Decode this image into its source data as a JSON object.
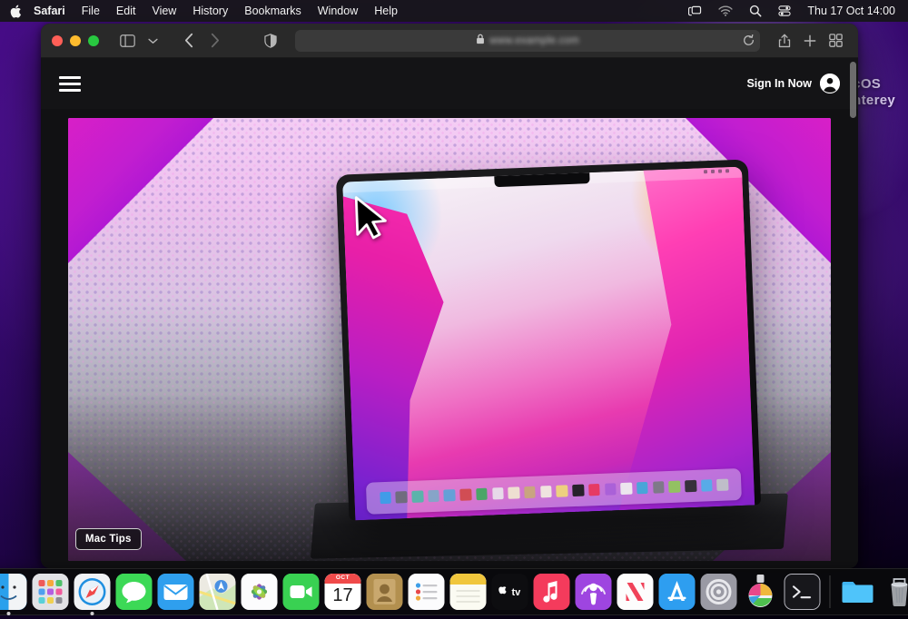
{
  "menubar": {
    "apple_icon": "apple-logo-icon",
    "items": [
      {
        "label": "Safari",
        "bold": true
      },
      {
        "label": "File",
        "bold": false
      },
      {
        "label": "Edit",
        "bold": false
      },
      {
        "label": "View",
        "bold": false
      },
      {
        "label": "History",
        "bold": false
      },
      {
        "label": "Bookmarks",
        "bold": false
      },
      {
        "label": "Window",
        "bold": false
      },
      {
        "label": "Help",
        "bold": false
      }
    ],
    "tray_icons": [
      "screen-mirroring-icon",
      "wifi-icon",
      "spotlight-search-icon",
      "control-center-icon"
    ],
    "clock": "Thu 17 Oct  14:00"
  },
  "desktop": {
    "wallpaper_line1": "macOS",
    "wallpaper_line2": "Monterey",
    "wallpaper_color": "#3c0a78"
  },
  "safari": {
    "toolbar": {
      "traffic_lights": [
        "close",
        "minimize",
        "zoom"
      ],
      "sidebar_label": "sidebar-toggle",
      "chevron_label": "tab-group-chevron",
      "back_label": "back",
      "forward_label": "forward",
      "shield_label": "privacy-report",
      "url_text": "www.example.com",
      "lock_label": "secure-lock",
      "reload_label": "reload",
      "share_label": "share",
      "newtab_label": "new-tab",
      "tabs_label": "tab-overview"
    },
    "page": {
      "menu_label": "site-menu",
      "signin_label": "Sign In Now",
      "avatar_label": "account-avatar",
      "badge_label": "Mac Tips"
    }
  },
  "dock": {
    "items": [
      {
        "name": "finder",
        "label": "Finder",
        "running": true
      },
      {
        "name": "launchpad",
        "label": "Launchpad",
        "running": false
      },
      {
        "name": "safari",
        "label": "Safari",
        "running": true
      },
      {
        "name": "messages",
        "label": "Messages",
        "running": false
      },
      {
        "name": "mail",
        "label": "Mail",
        "running": false
      },
      {
        "name": "maps",
        "label": "Maps",
        "running": false
      },
      {
        "name": "photos",
        "label": "Photos",
        "running": false
      },
      {
        "name": "facetime",
        "label": "FaceTime",
        "running": false
      },
      {
        "name": "calendar",
        "label": "Calendar",
        "running": false,
        "month": "OCT",
        "day": "17"
      },
      {
        "name": "contacts",
        "label": "Contacts",
        "running": false
      },
      {
        "name": "reminders",
        "label": "Reminders",
        "running": false
      },
      {
        "name": "notes",
        "label": "Notes",
        "running": false
      },
      {
        "name": "appletv",
        "label": "Apple TV",
        "running": false
      },
      {
        "name": "music",
        "label": "Music",
        "running": false
      },
      {
        "name": "podcasts",
        "label": "Podcasts",
        "running": false
      },
      {
        "name": "news",
        "label": "News",
        "running": false
      },
      {
        "name": "appstore",
        "label": "App Store",
        "running": false
      },
      {
        "name": "systemsettings",
        "label": "System Settings",
        "running": false
      },
      {
        "name": "safari-technology-preview",
        "label": "Safari Technology Preview",
        "running": false
      },
      {
        "name": "terminal",
        "label": "Terminal",
        "running": false
      },
      {
        "name": "downloads",
        "label": "Downloads",
        "running": false
      },
      {
        "name": "trash",
        "label": "Trash",
        "running": false
      }
    ]
  }
}
